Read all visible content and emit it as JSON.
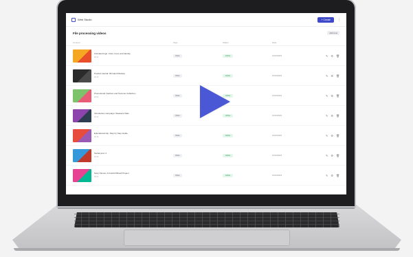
{
  "app": {
    "name": "Web Studio",
    "create_label": "+ Create",
    "menu_icon": "more-icon"
  },
  "section": {
    "title": "File processing videos",
    "action_label": "Add new"
  },
  "columns": [
    "Content",
    "Tags",
    "Status",
    "Date",
    ""
  ],
  "rows": [
    {
      "title": "Animated logo: Color, icons and identity",
      "meta": "00:12",
      "tag": "Video",
      "status": "Active",
      "date": "12/10/2023",
      "thumb": [
        "#f5a623",
        "#e94e2a"
      ]
    },
    {
      "title": "Product tutorial: 3D Hand Mockup",
      "meta": "00:15",
      "tag": "Video",
      "status": "Active",
      "date": "12/10/2023",
      "thumb": [
        "#2b2b2b",
        "#4a4a4a"
      ]
    },
    {
      "title": "Promotional: Fashion and Summer Collection",
      "meta": "00:22",
      "tag": "Video",
      "status": "Active",
      "date": "12/10/2023",
      "thumb": [
        "#7cc36b",
        "#e85d75"
      ]
    },
    {
      "title": "Introduction campaign: Weekend Sale",
      "meta": "00:10",
      "tag": "Video",
      "status": "Active",
      "date": "12/10/2023",
      "thumb": [
        "#8e44ad",
        "#2c3e50"
      ]
    },
    {
      "title": "Educational clip: Step by Step Guide",
      "meta": "00:18",
      "tag": "Video",
      "status": "Active",
      "date": "12/10/2023",
      "thumb": [
        "#e74c3c",
        "#9b59b6"
      ]
    },
    {
      "title": "Social post: 2",
      "meta": "00:08",
      "tag": "Video",
      "status": "Active",
      "date": "12/10/2023",
      "thumb": [
        "#3498db",
        "#c0392b"
      ]
    },
    {
      "title": "Story frames: A Colorful Brand Project",
      "meta": "00:20",
      "tag": "Video",
      "status": "Active",
      "date": "12/10/2023",
      "thumb": [
        "#e84393",
        "#00b894"
      ]
    }
  ],
  "colors": {
    "accent": "#3e4ac8",
    "play": "#4b58d6",
    "status_green": "#2e8b57"
  }
}
